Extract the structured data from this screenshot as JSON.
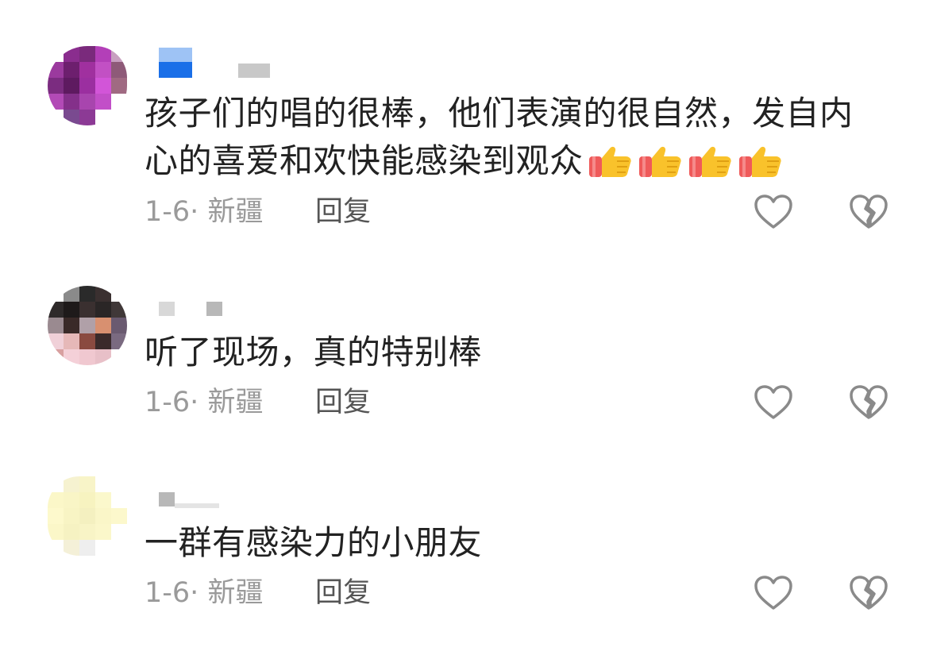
{
  "comments": [
    {
      "text": "孩子们的唱的很棒，他们表演的很自然，发自内心的喜爱和欢快能感染到观众",
      "emojis": [
        "thumbs-up",
        "thumbs-up",
        "thumbs-up",
        "thumbs-up"
      ],
      "date": "1-6",
      "separator": "·",
      "location": "新疆",
      "reply_label": "回复",
      "avatar_colors": [
        "#ffffff",
        "#8a2d8e",
        "#7a2a7c",
        "#b33fb8",
        "#c8a0c0",
        "#9b3a9e",
        "#6d1f6e",
        "#a0309f",
        "#c250c4",
        "#8e5a78",
        "#7b2c80",
        "#5e1a60",
        "#9b2fa0",
        "#d255d8",
        "#a06a82",
        "#b24ab6",
        "#84308a",
        "#a845ae",
        "#c24fc8",
        "#ffffff",
        "#ffffff",
        "#7a4a90",
        "#8c3a95",
        "#ffffff",
        "#ffffff"
      ],
      "username_colors": [
        "#9ec3f5",
        "#1a6fe8",
        "#c8c8c8"
      ]
    },
    {
      "text": "听了现场，真的特别棒",
      "emojis": [],
      "date": "1-6",
      "separator": "·",
      "location": "新疆",
      "reply_label": "回复",
      "avatar_colors": [
        "#ffffff",
        "#8a8a8a",
        "#2a2a2a",
        "#3a3030",
        "#ffffff",
        "#2e2a2a",
        "#1e1a1a",
        "#3a3030",
        "#2a2626",
        "#403838",
        "#9a8a90",
        "#3a2a28",
        "#b0a0a8",
        "#d89070",
        "#6a5a70",
        "#f0d0d8",
        "#e6b8b8",
        "#8a4a40",
        "#3a2a2a",
        "#7a6a80",
        "#d8a0a0",
        "#f4d0d8",
        "#f0c8d0",
        "#e8c0c8",
        "#ffffff"
      ],
      "username_colors": [
        "#d8d8d8",
        "#b8b8b8"
      ]
    },
    {
      "text": "一群有感染力的小朋友",
      "emojis": [],
      "date": "1-6",
      "separator": "·",
      "location": "新疆",
      "reply_label": "回复",
      "avatar_colors": [
        "#ffffff",
        "#f6f2d0",
        "#f8f4c8",
        "#ffffff",
        "#ffffff",
        "#fbf7c8",
        "#f9f5c6",
        "#f7f3c0",
        "#fbf8cc",
        "#ffffff",
        "#fdf9cc",
        "#f8f4c4",
        "#f4f0c0",
        "#faf6c8",
        "#fcf8cc",
        "#fbf7c8",
        "#f6f2c2",
        "#f8f4c6",
        "#fbf7ca",
        "#ffffff",
        "#ffffff",
        "#f4f0d8",
        "#eeeeee",
        "#ffffff",
        "#ffffff"
      ],
      "username_colors": [
        "#b8b8b8",
        "#e4e4e4"
      ]
    }
  ],
  "icons": {
    "like": "heart-outline-icon",
    "dislike": "broken-heart-icon",
    "emoji": "thumbs-up-emoji"
  },
  "colors": {
    "text": "#222222",
    "meta": "#9a9a9a",
    "reply": "#555555",
    "icon": "#8a8a8a"
  }
}
